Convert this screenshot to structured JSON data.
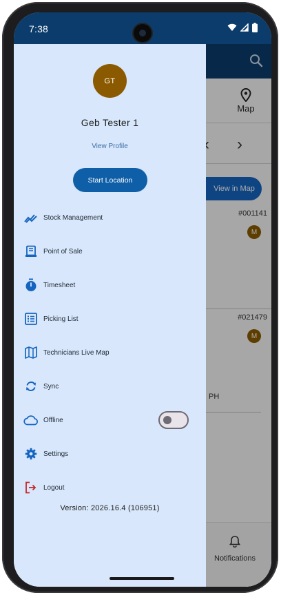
{
  "status_bar": {
    "time": "7:38"
  },
  "colors": {
    "app_bar": "#0b3c6b",
    "drawer_bg": "#d8e7fb",
    "accent": "#0f5fa8",
    "icon": "#1565c0",
    "avatar": "#8b5a00",
    "logout_icon": "#c62828"
  },
  "background": {
    "map_tab_label": "Map",
    "view_in_map_label": "View in Map",
    "job_1_number": "#001141",
    "job_2_number": "#021479",
    "assignee_initial": "M",
    "partial_text": "PH",
    "notifications_label": "Notifications"
  },
  "drawer": {
    "avatar_initials": "GT",
    "user_name": "Geb Tester 1",
    "view_profile": "View Profile",
    "start_location": "Start Location",
    "menu": [
      {
        "label": "Stock Management",
        "icon": "trending-chart-icon"
      },
      {
        "label": "Point of Sale",
        "icon": "receipt-icon"
      },
      {
        "label": "Timesheet",
        "icon": "stopwatch-icon"
      },
      {
        "label": "Picking List",
        "icon": "list-icon"
      },
      {
        "label": "Technicians Live Map",
        "icon": "map-icon"
      },
      {
        "label": "Sync",
        "icon": "sync-icon"
      },
      {
        "label": "Offline",
        "icon": "cloud-icon",
        "toggle": false
      },
      {
        "label": "Settings",
        "icon": "gear-icon"
      },
      {
        "label": "Logout",
        "icon": "logout-icon"
      }
    ],
    "version": "Version: 2026.16.4 (106951)"
  }
}
